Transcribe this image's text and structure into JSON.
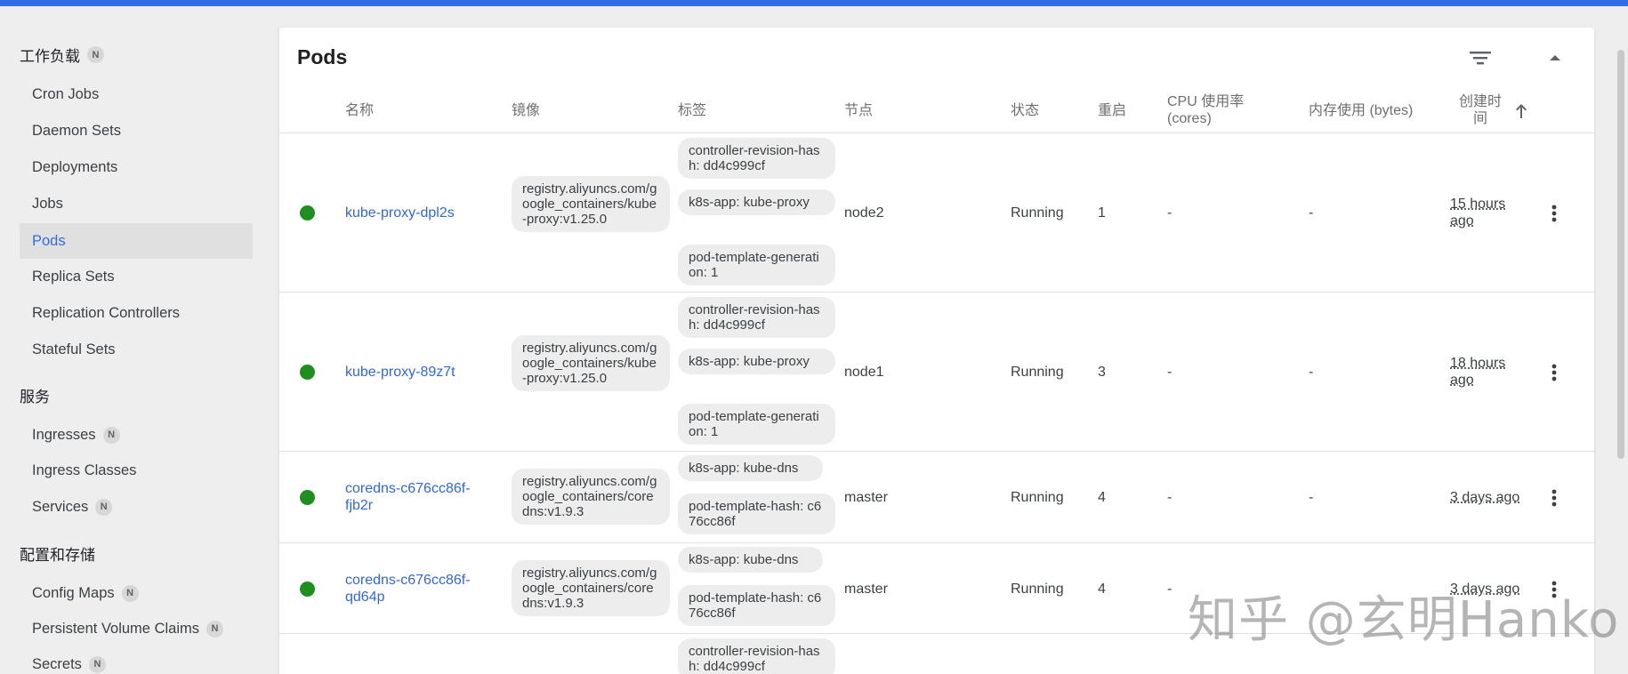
{
  "sidebar": {
    "workloads": {
      "label": "工作负载",
      "badge": "N"
    },
    "workload_items": [
      {
        "label": "Cron Jobs"
      },
      {
        "label": "Daemon Sets"
      },
      {
        "label": "Deployments"
      },
      {
        "label": "Jobs"
      },
      {
        "label": "Pods",
        "active": true
      },
      {
        "label": "Replica Sets"
      },
      {
        "label": "Replication Controllers"
      },
      {
        "label": "Stateful Sets"
      }
    ],
    "services": {
      "label": "服务"
    },
    "service_items": [
      {
        "label": "Ingresses",
        "badge": "N"
      },
      {
        "label": "Ingress Classes"
      },
      {
        "label": "Services",
        "badge": "N"
      }
    ],
    "config": {
      "label": "配置和存储"
    },
    "config_items": [
      {
        "label": "Config Maps",
        "badge": "N"
      },
      {
        "label": "Persistent Volume Claims",
        "badge": "N"
      },
      {
        "label": "Secrets",
        "badge": "N"
      }
    ]
  },
  "card": {
    "title": "Pods",
    "icons": {
      "filter": "filter-icon",
      "collapse": "chevron-up-icon",
      "sort": "arrow-up-icon",
      "more": "more-vert-icon"
    }
  },
  "columns": {
    "name": "名称",
    "image": "镜像",
    "labels": "标签",
    "node": "节点",
    "status": "状态",
    "restarts": "重启",
    "cpu_line1": "CPU 使用率",
    "cpu_line2": "(cores)",
    "memory": "内存使用 (bytes)",
    "created_line1": "创建时",
    "created_line2": "间"
  },
  "rows": [
    {
      "name": "kube-proxy-dpl2s",
      "image": "registry.aliyuncs.com/google_containers/kube-proxy:v1.25.0",
      "labels": [
        "controller-revision-hash: dd4c999cf",
        "k8s-app: kube-proxy",
        "pod-template-generation: 1"
      ],
      "node": "node2",
      "status": "Running",
      "restarts": "1",
      "cpu": "-",
      "memory": "-",
      "age": "15 hours ago"
    },
    {
      "name": "kube-proxy-89z7t",
      "image": "registry.aliyuncs.com/google_containers/kube-proxy:v1.25.0",
      "labels": [
        "controller-revision-hash: dd4c999cf",
        "k8s-app: kube-proxy",
        "pod-template-generation: 1"
      ],
      "node": "node1",
      "status": "Running",
      "restarts": "3",
      "cpu": "-",
      "memory": "-",
      "age": "18 hours ago"
    },
    {
      "name": "coredns-c676cc86f-fjb2r",
      "image": "registry.aliyuncs.com/google_containers/coredns:v1.9.3",
      "labels": [
        "k8s-app: kube-dns",
        "pod-template-hash: c676cc86f"
      ],
      "node": "master",
      "status": "Running",
      "restarts": "4",
      "cpu": "-",
      "memory": "-",
      "age": "3 days ago"
    },
    {
      "name": "coredns-c676cc86f-qd64p",
      "image": "registry.aliyuncs.com/google_containers/coredns:v1.9.3",
      "labels": [
        "k8s-app: kube-dns",
        "pod-template-hash: c676cc86f"
      ],
      "node": "master",
      "status": "Running",
      "restarts": "4",
      "cpu": "-",
      "age": "3 days ago"
    },
    {
      "labels": [
        "controller-revision-hash: dd4c999cf"
      ]
    }
  ],
  "colors": {
    "accent": "#326de6",
    "link": "#3367d6",
    "running": "#1e8e1e"
  },
  "watermark": "知乎 @玄明Hanko"
}
